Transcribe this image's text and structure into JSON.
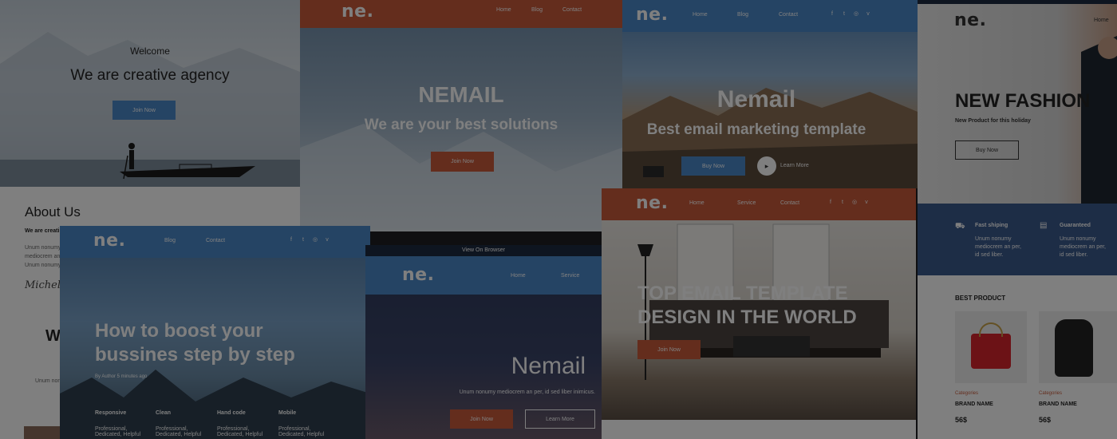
{
  "c1": {
    "welcome": "Welcome",
    "headline": "We are creative agency",
    "button": "Join Now",
    "about_title": "About Us",
    "about_lead": "We are creati",
    "about_text": [
      "Unum nonumy",
      "mediocrem an",
      "Unum nonumy"
    ],
    "signature": "Michel",
    "w": "W",
    "unum": "Unum non"
  },
  "c2": {
    "logo": "ne.",
    "nav": [
      "Home",
      "Blog",
      "Contact"
    ],
    "title": "NEMAIL",
    "subtitle": "We are your best solutions",
    "button": "Join Now"
  },
  "c3": {
    "logo": "ne.",
    "nav": [
      "Home",
      "Blog",
      "Contact"
    ],
    "title": "Nemail",
    "subtitle": "Best email marketing template",
    "buy": "Buy Now",
    "learn": "Learn More",
    "social": [
      "f",
      "t",
      "◎",
      "v"
    ]
  },
  "c4": {
    "logo": "ne.",
    "topbar_nav": "Home",
    "title": "NEW FASHION",
    "subtitle": "New Product for this holiday",
    "button": "Buy Now",
    "features": [
      {
        "title": "Fast shiping",
        "text": [
          "Unum nonumy",
          "mediocrem an per,",
          "id sed liber."
        ]
      },
      {
        "title": "Guaranteed",
        "text": [
          "Unum nonumy",
          "mediocrem an per,",
          "id sed liber."
        ]
      }
    ],
    "best": "BEST PRODUCT",
    "products": [
      {
        "category": "Categories",
        "name": "BRAND NAME",
        "price": "56$"
      },
      {
        "category": "Categories",
        "name": "BRAND NAME",
        "price": "56$"
      }
    ]
  },
  "c5": {
    "logo": "ne.",
    "nav": [
      "Blog",
      "Contact"
    ],
    "social": [
      "f",
      "t",
      "◎",
      "v"
    ],
    "title_line1": "How to boost your",
    "title_line2": "bussines step by step",
    "author": "By Author 5 minutes ago",
    "cols": [
      {
        "title": "Responsive",
        "text": "Professional, Dedicated, Helpful"
      },
      {
        "title": "Clean",
        "text": "Professional, Dedicated, Helpful"
      },
      {
        "title": "Hand code",
        "text": "Professional, Dedicated, Helpful"
      },
      {
        "title": "Mobile",
        "text": "Professional, Dedicated, Helpful"
      }
    ]
  },
  "c6": {
    "view": "View On Browser",
    "logo": "ne.",
    "nav": [
      "Home",
      "Service"
    ],
    "title": "Nemail",
    "text": "Unum nonumy mediocrem an per, id sed liber inimicus.",
    "join": "Join Now",
    "learn": "Learn More"
  },
  "c7": {
    "logo": "ne.",
    "nav": [
      "Home",
      "Service",
      "Contact"
    ],
    "social": [
      "f",
      "t",
      "◎",
      "v"
    ],
    "title_line1": "TOP EMAIL TEMPLATE",
    "title_line2": "DESIGN IN THE WORLD",
    "button": "Join Now"
  },
  "colors": {
    "orange": "#c95a3a",
    "blue": "#4a88c8",
    "navy": "#1c2a40"
  }
}
